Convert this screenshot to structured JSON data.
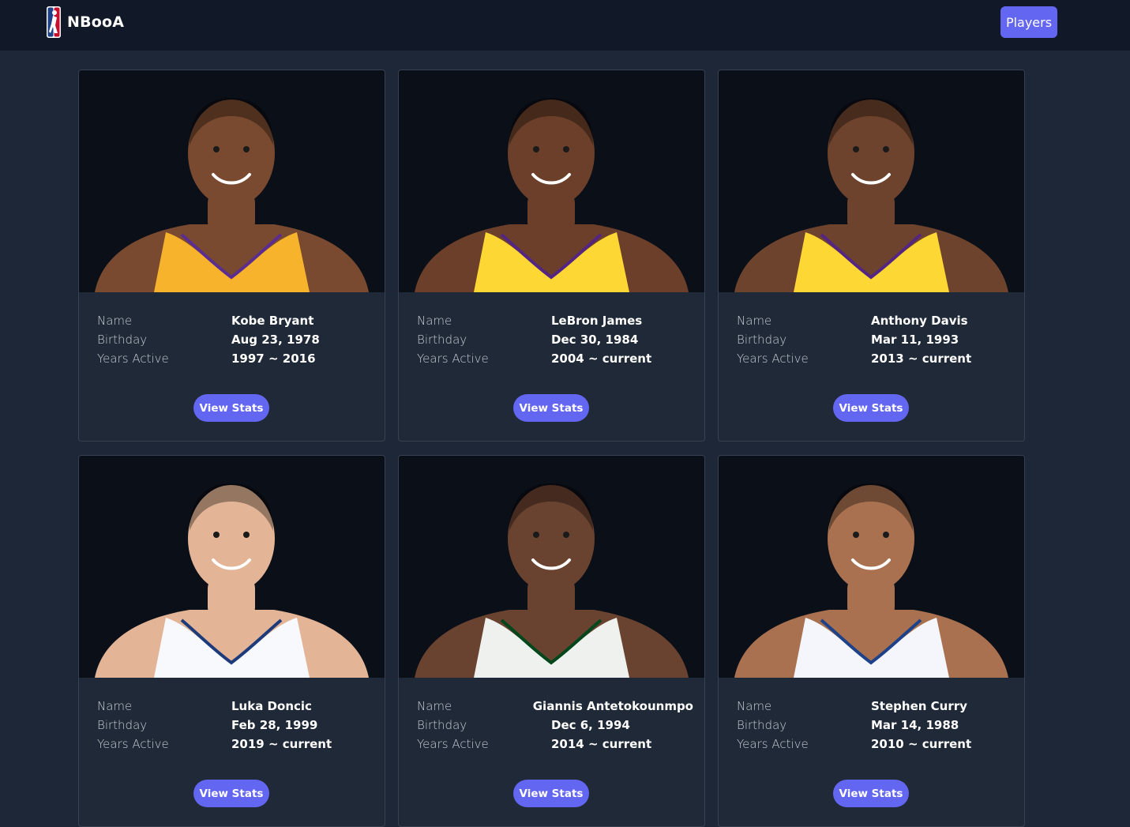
{
  "nav": {
    "brand": "NBooA",
    "players_label": "Players"
  },
  "labels": {
    "name": "Name",
    "birthday": "Birthday",
    "years_active": "Years Active",
    "view_stats": "View Stats"
  },
  "players": [
    {
      "name": "Kobe Bryant",
      "birthday": "Aug 23, 1978",
      "years_active": "1997 ~ 2016",
      "jersey_color": "#f6b32b",
      "trim_color": "#5c2d91",
      "skin_color": "#7a4a30"
    },
    {
      "name": "LeBron James",
      "birthday": "Dec 30, 1984",
      "years_active": "2004 ~ current",
      "jersey_color": "#fdd835",
      "trim_color": "#552583",
      "skin_color": "#6b3f2a"
    },
    {
      "name": "Anthony Davis",
      "birthday": "Mar 11, 1993",
      "years_active": "2013 ~ current",
      "jersey_color": "#fdd835",
      "trim_color": "#552583",
      "skin_color": "#6e432d"
    },
    {
      "name": "Luka Doncic",
      "birthday": "Feb 28, 1999",
      "years_active": "2019 ~ current",
      "jersey_color": "#f7f9fc",
      "trim_color": "#1d3b7a",
      "skin_color": "#e3b596"
    },
    {
      "name": "Giannis Antetokounmpo",
      "birthday": "Dec 6, 1994",
      "years_active": "2014 ~ current",
      "jersey_color": "#eef1ee",
      "trim_color": "#00471b",
      "skin_color": "#6a4330"
    },
    {
      "name": "Stephen Curry",
      "birthday": "Mar 14, 1988",
      "years_active": "2010 ~ current",
      "jersey_color": "#f5f6fb",
      "trim_color": "#1d428a",
      "skin_color": "#a9714f"
    }
  ]
}
